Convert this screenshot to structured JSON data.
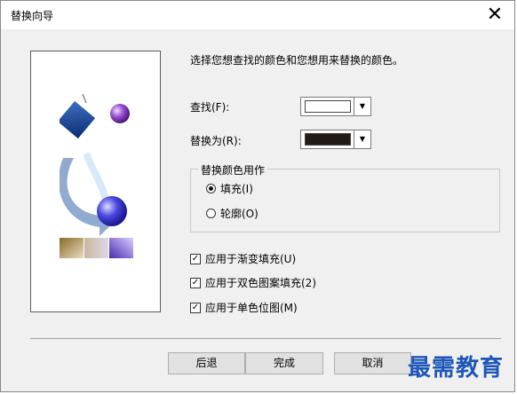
{
  "window": {
    "title": "替换向导",
    "close_glyph": "✕"
  },
  "instruction": "选择您想查找的颜色和您想用来替换的颜色。",
  "find": {
    "label": "查找(F):",
    "swatch_color": "#ffffff"
  },
  "replace": {
    "label": "替换为(R):",
    "swatch_color": "#211a16"
  },
  "apply_group": {
    "title": "替换颜色用作",
    "options": [
      {
        "label": "填充(I)",
        "selected": true
      },
      {
        "label": "轮廓(O)",
        "selected": false
      }
    ]
  },
  "checkboxes": [
    {
      "label": "应用于渐变填充(U)",
      "checked": true
    },
    {
      "label": "应用于双色图案填充(2)",
      "checked": true
    },
    {
      "label": "应用于单色位图(M)",
      "checked": true
    }
  ],
  "buttons": {
    "back": "后退",
    "finish": "完成",
    "cancel": "取消"
  },
  "check_glyph": "✓",
  "dropdown_glyph": "▼",
  "watermark": "最需教育"
}
